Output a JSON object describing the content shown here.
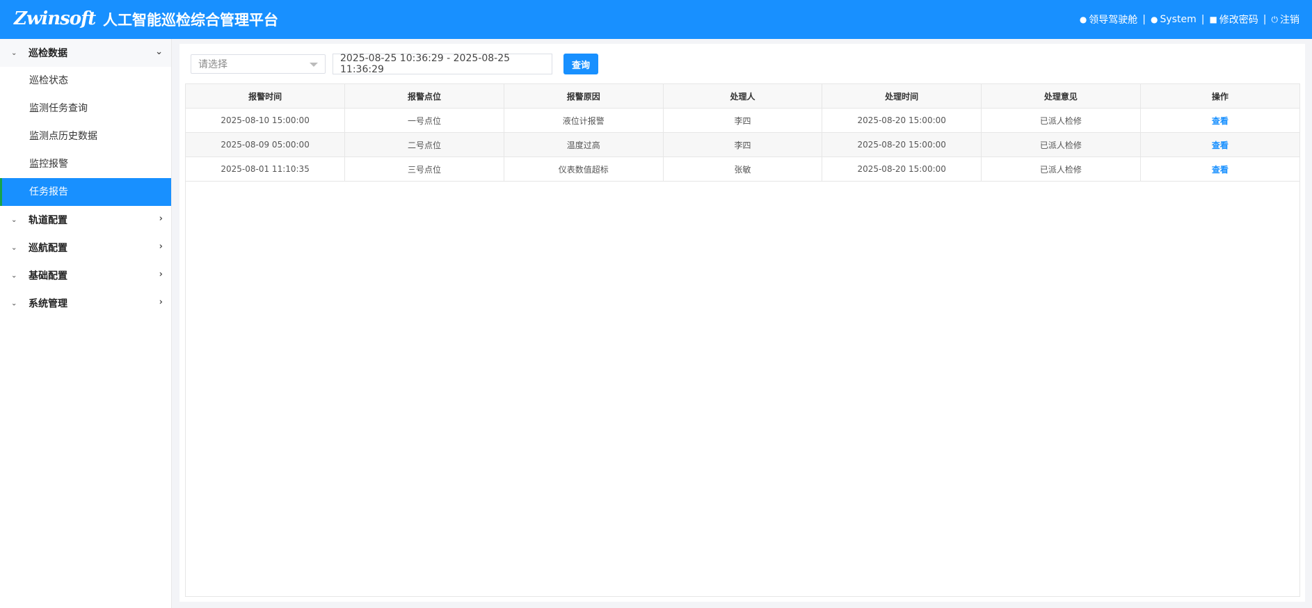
{
  "header": {
    "logo": "Zwinsoft",
    "title": "人工智能巡检综合管理平台",
    "links": [
      {
        "icon": "globe-icon",
        "glyph": "●",
        "label": "领导驾驶舱"
      },
      {
        "icon": "user-icon",
        "glyph": "●",
        "label": "System"
      },
      {
        "icon": "lock-icon",
        "glyph": "■",
        "label": "修改密码"
      },
      {
        "icon": "power-icon",
        "glyph": "⏻",
        "label": "注销"
      }
    ],
    "separator": "|"
  },
  "sidebar": {
    "groups": [
      {
        "label": "巡检数据",
        "expanded": true
      },
      {
        "label": "轨道配置",
        "expanded": false
      },
      {
        "label": "巡航配置",
        "expanded": false
      },
      {
        "label": "基础配置",
        "expanded": false
      },
      {
        "label": "系统管理",
        "expanded": false
      }
    ],
    "sub_items": [
      "巡检状态",
      "监测任务查询",
      "监测点历史数据",
      "监控报警",
      "任务报告"
    ],
    "active_item": "任务报告",
    "lead_glyph": "⌄",
    "down_glyph": "⌄",
    "right_glyph": "›"
  },
  "filter": {
    "select_placeholder": "请选择",
    "date_range": "2025-08-25 10:36:29 - 2025-08-25 11:36:29",
    "query_button": "查询"
  },
  "table": {
    "columns": [
      "报警时间",
      "报警点位",
      "报警原因",
      "处理人",
      "处理时间",
      "处理意见",
      "操作"
    ],
    "rows": [
      [
        "2025-08-10 15:00:00",
        "一号点位",
        "液位计报警",
        "李四",
        "2025-08-20 15:00:00",
        "已派人检修",
        "查看"
      ],
      [
        "2025-08-09 05:00:00",
        "二号点位",
        "温度过高",
        "李四",
        "2025-08-20 15:00:00",
        "已派人检修",
        "查看"
      ],
      [
        "2025-08-01 11:10:35",
        "三号点位",
        "仪表数值超标",
        "张敏",
        "2025-08-20 15:00:00",
        "已派人检修",
        "查看"
      ]
    ]
  }
}
